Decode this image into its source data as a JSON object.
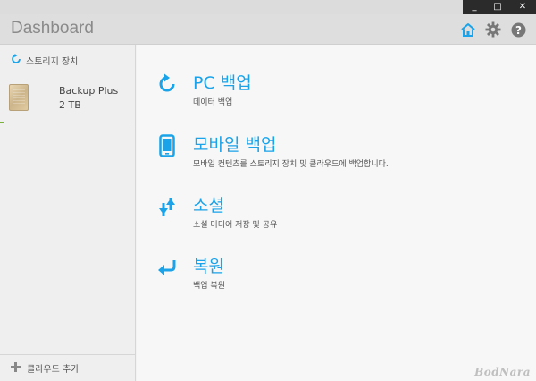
{
  "window": {
    "controls": {
      "minimize": "_",
      "maximize": "□",
      "close": "✕"
    }
  },
  "header": {
    "title": "Dashboard",
    "icons": [
      "home-icon",
      "gear-icon",
      "help-icon"
    ],
    "accent_color": "#1aa3e8"
  },
  "sidebar": {
    "section_label": "스토리지 장치",
    "device": {
      "name": "Backup Plus",
      "size": "2 TB"
    },
    "footer_label": "클라우드 추가"
  },
  "main": {
    "actions": [
      {
        "title": "PC 백업",
        "desc": "데이터 백업",
        "icon": "refresh-icon"
      },
      {
        "title": "모바일 백업",
        "desc": "모바일 컨텐츠를 스토리지 장치 및 클라우드에 백업합니다.",
        "icon": "phone-icon"
      },
      {
        "title": "소셜",
        "desc": "소셜 미디어 저장 및 공유",
        "icon": "transfer-arrows-icon"
      },
      {
        "title": "복원",
        "desc": "백업 복원",
        "icon": "restore-arrow-icon"
      }
    ]
  },
  "watermark": "BodNara"
}
